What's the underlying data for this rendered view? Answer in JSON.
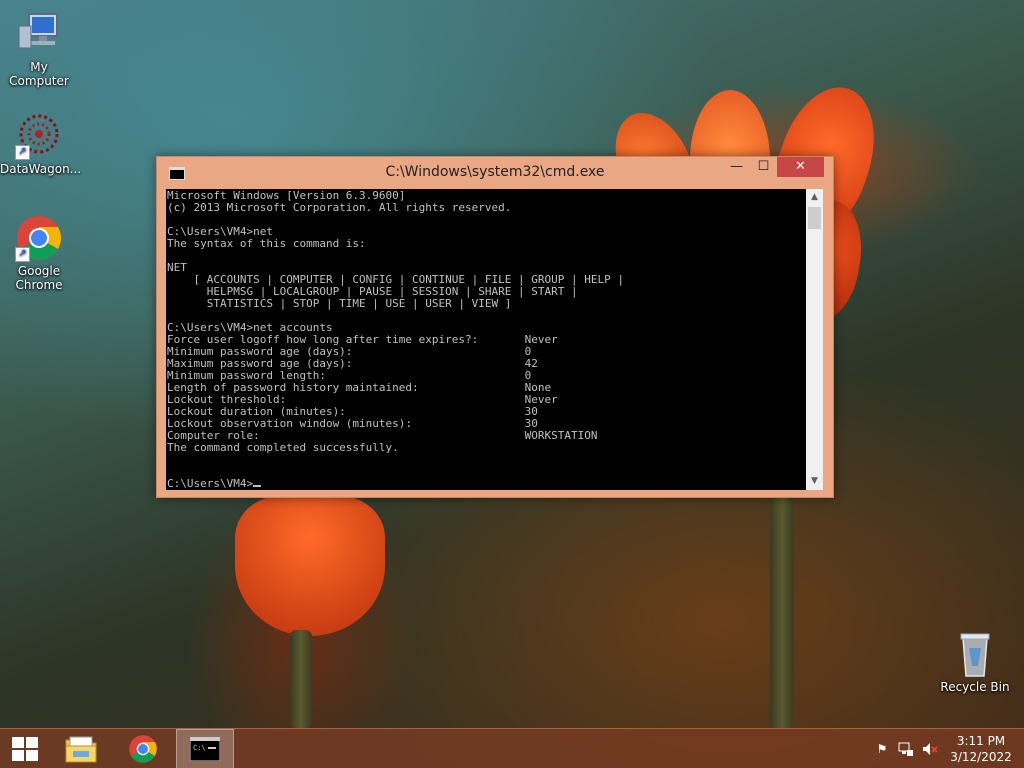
{
  "desktop": {
    "icons": [
      {
        "label": "My Computer",
        "icon": "computer-icon"
      },
      {
        "label": "DataWagon...",
        "icon": "datawagon-icon"
      },
      {
        "label": "Google Chrome",
        "icon": "chrome-icon"
      },
      {
        "label": "Recycle Bin",
        "icon": "recycle-bin-icon"
      }
    ]
  },
  "cmd_window": {
    "title": "C:\\Windows\\system32\\cmd.exe",
    "controls": {
      "minimize": "—",
      "maximize": "☐",
      "close": "✕"
    },
    "console_lines": [
      "Microsoft Windows [Version 6.3.9600]",
      "(c) 2013 Microsoft Corporation. All rights reserved.",
      "",
      "C:\\Users\\VM4>net",
      "The syntax of this command is:",
      "",
      "NET",
      "    [ ACCOUNTS | COMPUTER | CONFIG | CONTINUE | FILE | GROUP | HELP |",
      "      HELPMSG | LOCALGROUP | PAUSE | SESSION | SHARE | START |",
      "      STATISTICS | STOP | TIME | USE | USER | VIEW ]",
      "",
      "C:\\Users\\VM4>net accounts",
      "Force user logoff how long after time expires?:       Never",
      "Minimum password age (days):                          0",
      "Maximum password age (days):                          42",
      "Minimum password length:                              0",
      "Length of password history maintained:                None",
      "Lockout threshold:                                    Never",
      "Lockout duration (minutes):                           30",
      "Lockout observation window (minutes):                 30",
      "Computer role:                                        WORKSTATION",
      "The command completed successfully.",
      "",
      ""
    ],
    "prompt": "C:\\Users\\VM4>"
  },
  "taskbar": {
    "pinned": [
      {
        "icon": "windows-start-icon"
      },
      {
        "icon": "file-explorer-icon"
      },
      {
        "icon": "chrome-icon"
      },
      {
        "icon": "cmd-icon",
        "active": true
      }
    ],
    "tray_icons": [
      "action-center-flag-icon",
      "network-icon",
      "volume-muted-icon"
    ],
    "time": "3:11 PM",
    "date": "3/12/2022"
  },
  "colors": {
    "window_frame": "#e9a784",
    "close_button": "#c74646",
    "console_bg": "#000000",
    "console_text": "#c0c0c0",
    "taskbar": "#783c23"
  }
}
